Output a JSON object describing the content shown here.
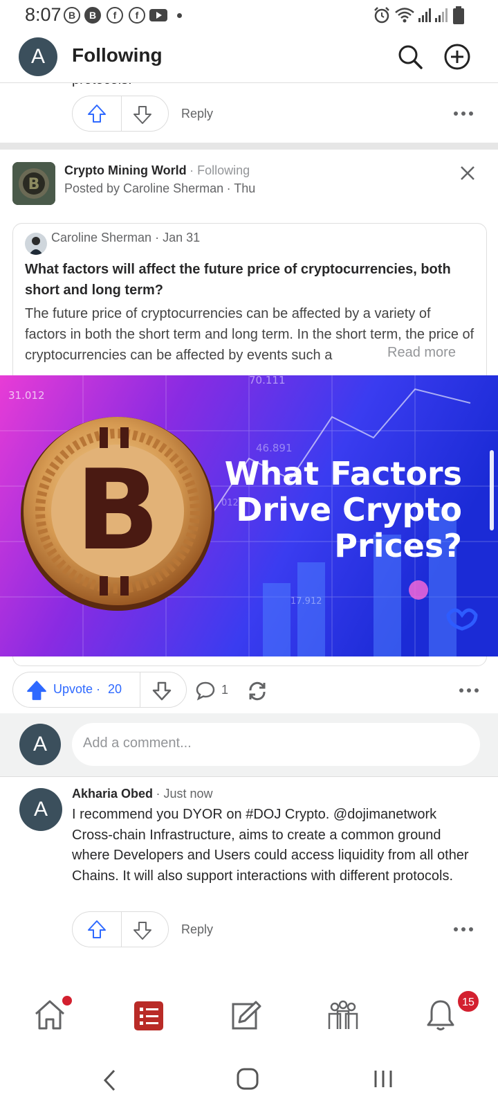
{
  "status_bar": {
    "time": "8:07",
    "app_icons": [
      "b-circle-icon",
      "b-filled-circle-icon",
      "facebook-icon",
      "facebook-icon",
      "youtube-icon",
      "dot-icon"
    ],
    "system_icons": [
      "alarm-icon",
      "wifi-icon",
      "signal-icon",
      "signal-icon",
      "battery-icon"
    ]
  },
  "header": {
    "avatar_letter": "A",
    "title": "Following"
  },
  "prev_comment": {
    "tail_text": "protocols.",
    "reply_label": "Reply"
  },
  "post": {
    "space_name": "Crypto Mining World",
    "follow_status": "· Following",
    "posted_by": "Posted by Caroline Sherman",
    "posted_when": "· Thu",
    "author": "Caroline Sherman",
    "author_date": "· Jan 31",
    "question": "What factors will affect the future price of cryptocurrencies, both short and long term?",
    "excerpt": "The future price of cryptocurrencies can be affected by a variety of factors in both the short term and long term. In the short term, the price of cryptocurrencies can be affected by events such a",
    "read_more": "Read more",
    "image": {
      "headline_line1": "What Factors",
      "headline_line2": "Drive Crypto",
      "headline_line3": "Prices?",
      "corner_text_1": "31.012",
      "corner_text_2": "70.111",
      "corner_text_3": "46.891",
      "corner_text_4": "012",
      "corner_text_5": "17.912"
    },
    "upvote_label": "Upvote ·",
    "upvote_count": "20",
    "comment_count": "1"
  },
  "comment_box": {
    "avatar_letter": "A",
    "placeholder": "Add a comment..."
  },
  "comment": {
    "avatar_letter": "A",
    "author": "Akharia Obed",
    "time": "· Just now",
    "text": "I recommend you DYOR on #DOJ Crypto. @dojimanetwork Cross-chain Infrastructure, aims to create a common ground where Developers and Users could access liquidity from all other Chains. It will also support interactions with different protocols.",
    "reply_label": "Reply"
  },
  "bottom_nav": {
    "items": [
      "home-icon",
      "following-icon",
      "answer-icon",
      "spaces-icon",
      "notifications-icon"
    ],
    "notifications_badge": "15"
  },
  "colors": {
    "quora_red": "#b92b27",
    "upvote_blue": "#2e69ff",
    "avatar": "#3b4f5c",
    "badge": "#d3202f"
  }
}
